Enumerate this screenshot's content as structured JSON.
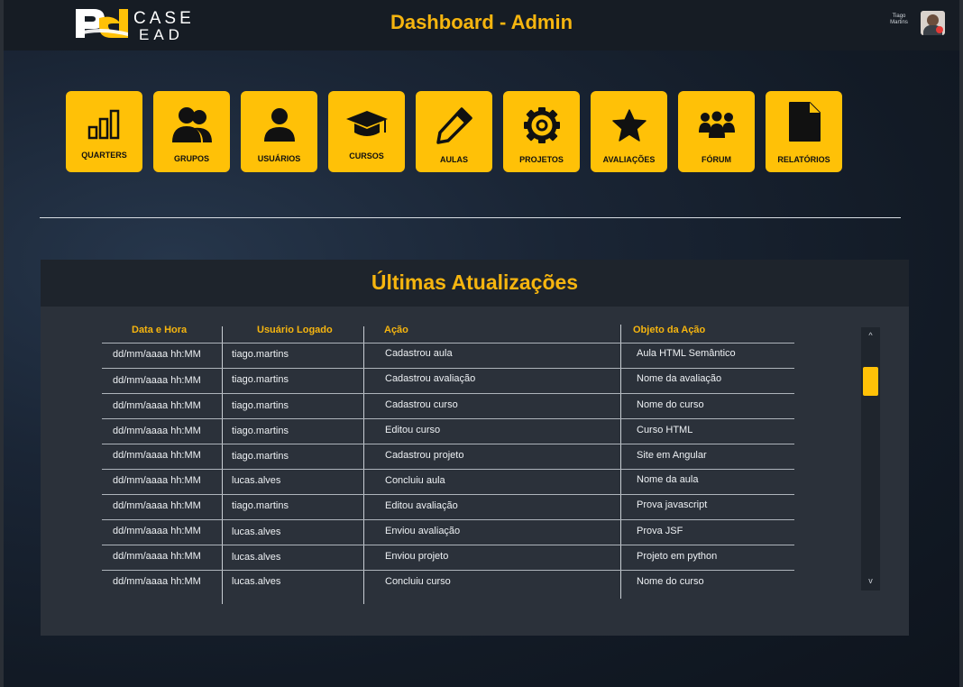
{
  "header": {
    "logo_case": "CASE",
    "logo_ead": "EAD",
    "title": "Dashboard - Admin",
    "user_first": "Tiago",
    "user_last": "Martins"
  },
  "tiles": [
    {
      "label": "QUARTERS",
      "icon": "bar-chart-icon"
    },
    {
      "label": "GRUPOS",
      "icon": "users-icon"
    },
    {
      "label": "USUÁRIOS",
      "icon": "user-icon"
    },
    {
      "label": "CURSOS",
      "icon": "graduation-cap-icon"
    },
    {
      "label": "AULAS",
      "icon": "pencil-icon"
    },
    {
      "label": "PROJETOS",
      "icon": "gear-icon"
    },
    {
      "label": "AVALIAÇÕES",
      "icon": "star-icon"
    },
    {
      "label": "FÓRUM",
      "icon": "people-group-icon"
    },
    {
      "label": "RELATÓRIOS",
      "icon": "file-icon"
    }
  ],
  "updates": {
    "title": "Últimas Atualizações",
    "columns": [
      "Data e Hora",
      "Usuário Logado",
      "Ação",
      "Objeto da Ação"
    ],
    "rows": [
      [
        "dd/mm/aaaa hh:MM",
        "tiago.martins",
        "Cadastrou aula",
        "Aula HTML Semântico"
      ],
      [
        "dd/mm/aaaa hh:MM",
        "tiago.martins",
        "Cadastrou avaliação",
        "Nome da avaliação"
      ],
      [
        "dd/mm/aaaa hh:MM",
        "tiago.martins",
        "Cadastrou curso",
        "Nome do curso"
      ],
      [
        "dd/mm/aaaa hh:MM",
        "tiago.martins",
        "Editou curso",
        "Curso HTML"
      ],
      [
        "dd/mm/aaaa hh:MM",
        "tiago.martins",
        "Cadastrou projeto",
        "Site em Angular"
      ],
      [
        "dd/mm/aaaa hh:MM",
        "lucas.alves",
        "Concluiu aula",
        "Nome da aula"
      ],
      [
        "dd/mm/aaaa hh:MM",
        "tiago.martins",
        "Editou avaliação",
        "Prova javascript"
      ],
      [
        "dd/mm/aaaa hh:MM",
        "lucas.alves",
        "Enviou avaliação",
        "Prova JSF"
      ],
      [
        "dd/mm/aaaa hh:MM",
        "lucas.alves",
        "Enviou projeto",
        "Projeto em python"
      ],
      [
        "dd/mm/aaaa hh:MM",
        "lucas.alves",
        "Concluiu curso",
        "Nome do curso"
      ]
    ],
    "scroll_up": "^",
    "scroll_down": "v"
  },
  "colors": {
    "accent": "#ffc107",
    "accent_text": "#f6b50f",
    "panel": "#2b313a",
    "topbar": "#161c24"
  }
}
